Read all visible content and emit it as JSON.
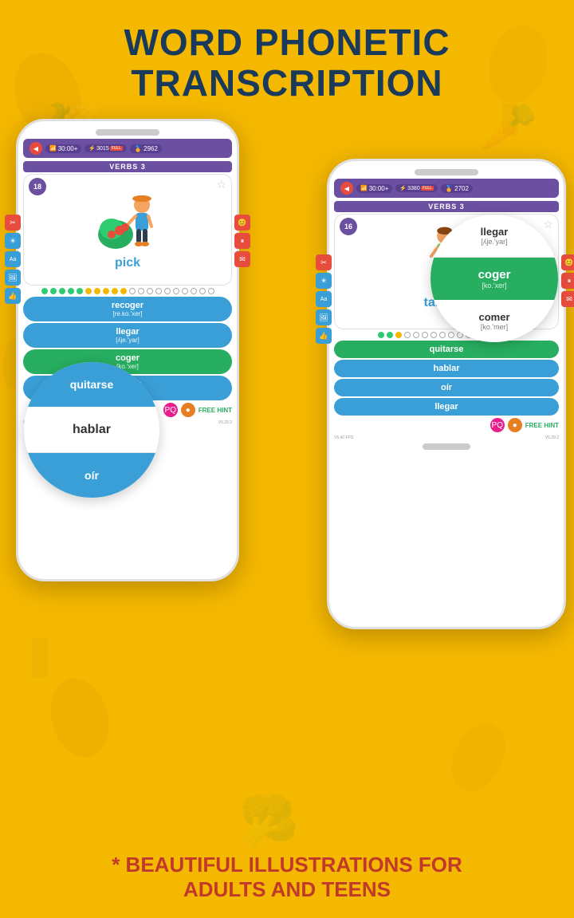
{
  "title": {
    "line1": "WORD PHONETIC",
    "line2": "TRANSCRIPTION"
  },
  "phone_left": {
    "speaker": true,
    "status": {
      "time": "30:00+",
      "score": "3015",
      "full": "FULL",
      "coins": "2962"
    },
    "verbs_label": "VERBS 3",
    "card": {
      "number": "18",
      "word": "pick",
      "star": "☆"
    },
    "progress": {
      "green_dots": 5,
      "yellow_dots": 5,
      "outline_dots": 10
    },
    "answers": [
      {
        "word": "recoger",
        "phonetic": "[re.ko.'xer]",
        "type": "blue"
      },
      {
        "word": "llegar",
        "phonetic": "[ʎje.'yar]",
        "type": "blue"
      },
      {
        "word": "coger",
        "phonetic": "[ko.'xer]",
        "type": "green"
      },
      {
        "word": "comer",
        "phonetic": "[ko.'mer]",
        "type": "blue"
      }
    ],
    "hint": "FREE HINT",
    "fps": "V5.21 FPS",
    "version": "V5.29.2"
  },
  "phone_right": {
    "status": {
      "time": "30:00+",
      "score": "3380",
      "full": "FULL",
      "coins": "2702"
    },
    "verbs_label": "VERBS 3",
    "card": {
      "number": "16",
      "word": "take off",
      "star": "☆"
    },
    "progress": {
      "green_dots": 2,
      "yellow_dots": 1,
      "outline_dots": 13
    },
    "answers": [
      {
        "word": "quitarse",
        "type": "green"
      },
      {
        "word": "hablar",
        "type": "blue"
      },
      {
        "word": "oír",
        "type": "blue"
      },
      {
        "word": "llegar",
        "type": "blue"
      }
    ],
    "hint": "FREE HINT",
    "fps": "V5.42 FPS",
    "version": "V5.29.2"
  },
  "circle_top_right": {
    "items": [
      {
        "word": "llegar",
        "phonetic": "[ʎje.'yar]",
        "type": "white"
      },
      {
        "word": "coger",
        "phonetic": "[ko.'xer]",
        "type": "green"
      },
      {
        "word": "comer",
        "phonetic": "[ko.'mer]",
        "type": "white"
      }
    ]
  },
  "circle_bottom_left": {
    "items": [
      {
        "word": "quitarse",
        "type": "blue"
      },
      {
        "word": "hablar",
        "type": "white"
      },
      {
        "word": "oír",
        "type": "blue"
      }
    ]
  },
  "bottom_text": {
    "line1": "* BEAUTIFUL ILLUSTRATIONS FOR",
    "line2": "ADULTS AND TEENS"
  },
  "colors": {
    "background": "#F5B800",
    "title": "#1a3a5c",
    "phone_purple": "#6b4fa0",
    "answer_blue": "#3a9fd6",
    "answer_green": "#27ae60",
    "hint_pink": "#e91e8c",
    "hint_orange": "#e67e22",
    "bottom_text": "#c0392b"
  }
}
